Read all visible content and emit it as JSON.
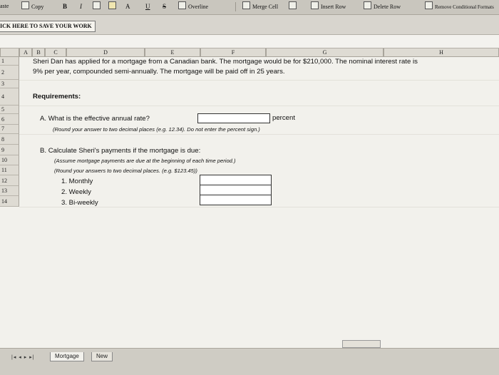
{
  "toolbar": {
    "paste_label": "aste",
    "copy_label": "Copy",
    "bold_label": "B",
    "italic_label": "I",
    "overline_label": "Overline",
    "merge_label": "Merge Cell",
    "insert_row_label": "Insert Row",
    "delete_row_label": "Delete Row",
    "remove_cf_label": "Remove Conditional Formats"
  },
  "save_button": {
    "label": "ICK HERE TO SAVE YOUR WORK"
  },
  "columns": [
    "A",
    "B",
    "C",
    "D",
    "E",
    "F",
    "G",
    "H"
  ],
  "rows": [
    "1",
    "2",
    "3",
    "4",
    "5",
    "6",
    "7",
    "8",
    "9",
    "10",
    "11",
    "12",
    "13",
    "14"
  ],
  "content": {
    "intro_line1": "Sheri Dan has applied for a mortgage from a Canadian bank. The mortgage would be for $210,000. The nominal interest rate is",
    "intro_line2": "9% per year, compounded semi-annually.  The mortgage will be paid off in 25 years.",
    "requirements": "Requirements:",
    "question_a": "A.  What is the effective annual rate?",
    "percent_label": "percent",
    "note_a": "(Round your answer to two decimal places (e.g. 12.34). Do not enter the percent sign.)",
    "question_b": "B.  Calculate Sheri's payments if the mortgage is due:",
    "note_b1": "(Assume mortgage payments are due at the beginning of each time period.)",
    "note_b2": "(Round your answers to two decimal places. (e.g. $123.45))",
    "item1": "1.  Monthly",
    "item2": "2.  Weekly",
    "item3": "3.  Bi-weekly"
  },
  "sheet_tabs": [
    "Mortgage",
    "New"
  ]
}
